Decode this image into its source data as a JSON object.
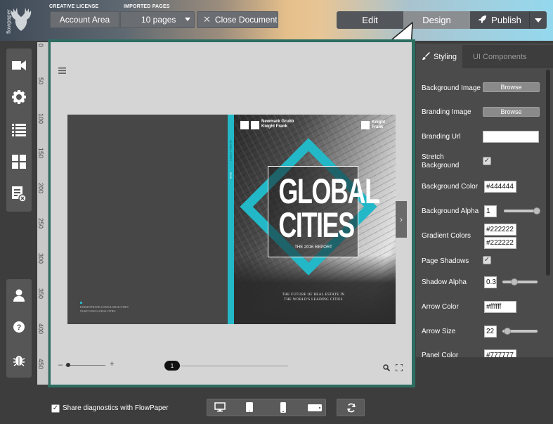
{
  "app": {
    "brand": "flowpaper"
  },
  "topbar": {
    "license_label": "CREATIVE LICENSE",
    "imported_label": "IMPORTED PAGES",
    "account_button": "Account Area",
    "pages_select": "10 pages",
    "close_button": "Close Document",
    "modes": {
      "edit": "Edit",
      "design": "Design",
      "publish": "Publish"
    }
  },
  "ruler": {
    "marks": [
      "0",
      "50",
      "100",
      "150",
      "200",
      "250",
      "300",
      "350",
      "400",
      "450"
    ]
  },
  "book": {
    "back_cover": {
      "url_line1": "KNIGHTFRANK.COM/GLOBALCITIES",
      "url_line2": "NGKF.COM/GLOBALCITIES"
    },
    "spine": {
      "text": "GLOBAL CITIES",
      "sub": "2016"
    },
    "front_cover": {
      "partner_line1": "Newmark Grubb",
      "partner_line2": "Knight Frank",
      "brand_line1": "Knight",
      "brand_line2": "Frank",
      "title_line1": "GLOBAL",
      "title_line2": "CITIES",
      "subtitle": "THE 2016 REPORT",
      "tagline_line1": "THE FUTURE OF REAL ESTATE IN",
      "tagline_line2": "THE WORLD'S LEADING CITIES"
    }
  },
  "viewer": {
    "page_indicator": "1"
  },
  "panel": {
    "tabs": {
      "styling": "Styling",
      "components": "UI Components"
    },
    "browse_label": "Browse",
    "rows": {
      "background_image": "Background Image",
      "branding_image": "Branding Image",
      "branding_url": "Branding Url",
      "stretch_bg_line1": "Stretch",
      "stretch_bg_line2": "Background",
      "background_color": "Background Color",
      "background_alpha": "Background Alpha",
      "gradient_colors": "Gradient Colors",
      "page_shadows": "Page Shadows",
      "shadow_alpha": "Shadow Alpha",
      "arrow_color": "Arrow Color",
      "arrow_size": "Arrow Size",
      "panel_color": "Panel Color"
    },
    "values": {
      "branding_url": "",
      "background_color": "#444444",
      "background_alpha": "1",
      "gradient_1": "#222222",
      "gradient_2": "#222222",
      "shadow_alpha": "0.3",
      "arrow_color": "#ffffff",
      "arrow_size": "22",
      "panel_color": "#777777"
    },
    "sliders": {
      "background_alpha": 1.0,
      "shadow_alpha": 0.3,
      "arrow_size": 0.22
    }
  },
  "footer": {
    "share_label": "Share diagnostics with FlowPaper"
  },
  "colors": {
    "accent_cyan": "#23b8c7",
    "stage_border": "#2d6e61"
  }
}
